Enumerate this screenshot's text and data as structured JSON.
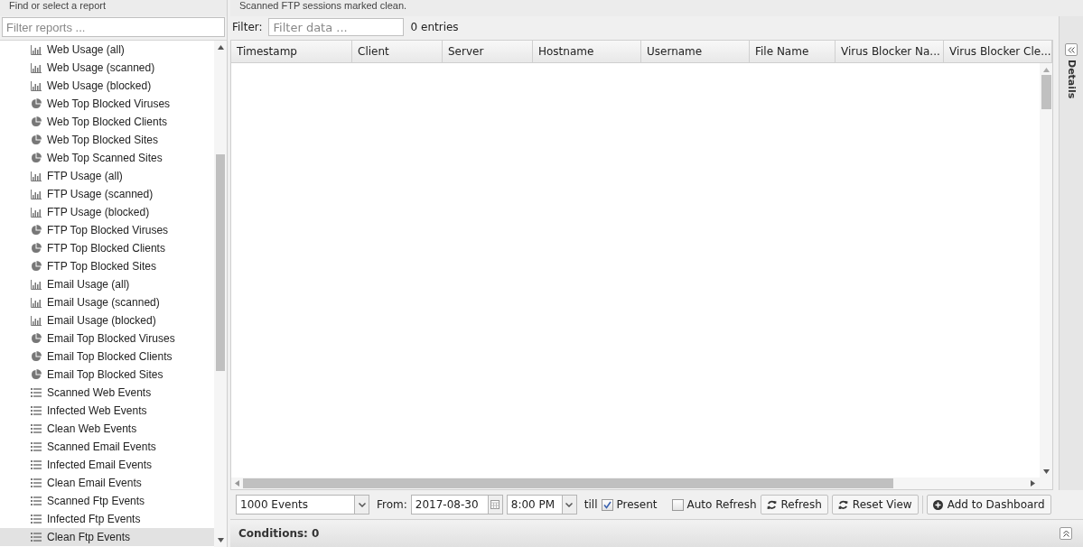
{
  "sidebar": {
    "title": "Find or select a report",
    "filter": {
      "placeholder": "Filter reports ..."
    },
    "items": [
      {
        "kind": "bar",
        "label": "Web Usage (all)",
        "selected": false
      },
      {
        "kind": "bar",
        "label": "Web Usage (scanned)",
        "selected": false
      },
      {
        "kind": "bar",
        "label": "Web Usage (blocked)",
        "selected": false
      },
      {
        "kind": "pie",
        "label": "Web Top Blocked Viruses",
        "selected": false
      },
      {
        "kind": "pie",
        "label": "Web Top Blocked Clients",
        "selected": false
      },
      {
        "kind": "pie",
        "label": "Web Top Blocked Sites",
        "selected": false
      },
      {
        "kind": "pie",
        "label": "Web Top Scanned Sites",
        "selected": false
      },
      {
        "kind": "bar",
        "label": "FTP Usage (all)",
        "selected": false
      },
      {
        "kind": "bar",
        "label": "FTP Usage (scanned)",
        "selected": false
      },
      {
        "kind": "bar",
        "label": "FTP Usage (blocked)",
        "selected": false
      },
      {
        "kind": "pie",
        "label": "FTP Top Blocked Viruses",
        "selected": false
      },
      {
        "kind": "pie",
        "label": "FTP Top Blocked Clients",
        "selected": false
      },
      {
        "kind": "pie",
        "label": "FTP Top Blocked Sites",
        "selected": false
      },
      {
        "kind": "bar",
        "label": "Email Usage (all)",
        "selected": false
      },
      {
        "kind": "bar",
        "label": "Email Usage (scanned)",
        "selected": false
      },
      {
        "kind": "bar",
        "label": "Email Usage (blocked)",
        "selected": false
      },
      {
        "kind": "pie",
        "label": "Email Top Blocked Viruses",
        "selected": false
      },
      {
        "kind": "pie",
        "label": "Email Top Blocked Clients",
        "selected": false
      },
      {
        "kind": "pie",
        "label": "Email Top Blocked Sites",
        "selected": false
      },
      {
        "kind": "list",
        "label": "Scanned Web Events",
        "selected": false
      },
      {
        "kind": "list",
        "label": "Infected Web Events",
        "selected": false
      },
      {
        "kind": "list",
        "label": "Clean Web Events",
        "selected": false
      },
      {
        "kind": "list",
        "label": "Scanned Email Events",
        "selected": false
      },
      {
        "kind": "list",
        "label": "Infected Email Events",
        "selected": false
      },
      {
        "kind": "list",
        "label": "Clean Email Events",
        "selected": false
      },
      {
        "kind": "list",
        "label": "Scanned Ftp Events",
        "selected": false
      },
      {
        "kind": "list",
        "label": "Infected Ftp Events",
        "selected": false
      },
      {
        "kind": "list",
        "label": "Clean Ftp Events",
        "selected": true
      }
    ]
  },
  "report": {
    "description": "Scanned FTP sessions marked clean.",
    "filter_label": "Filter:",
    "filter": {
      "placeholder": "Filter data ..."
    },
    "entries": "0 entries",
    "columns": [
      "Timestamp",
      "Client",
      "Server",
      "Hostname",
      "Username",
      "File Name",
      "Virus Blocker Na...",
      "Virus Blocker Cle..."
    ]
  },
  "details_tab": "Details",
  "toolbar": {
    "limit": "1000 Events",
    "from_label": "From:",
    "date": "2017-08-30",
    "time": "8:00 PM",
    "till_label": "till",
    "present": {
      "label": "Present",
      "checked": true
    },
    "auto_refresh": {
      "label": "Auto Refresh",
      "checked": false
    },
    "refresh": "Refresh",
    "reset_view": "Reset View",
    "add_to_dashboard": "Add to Dashboard"
  },
  "conditions": "Conditions: 0"
}
